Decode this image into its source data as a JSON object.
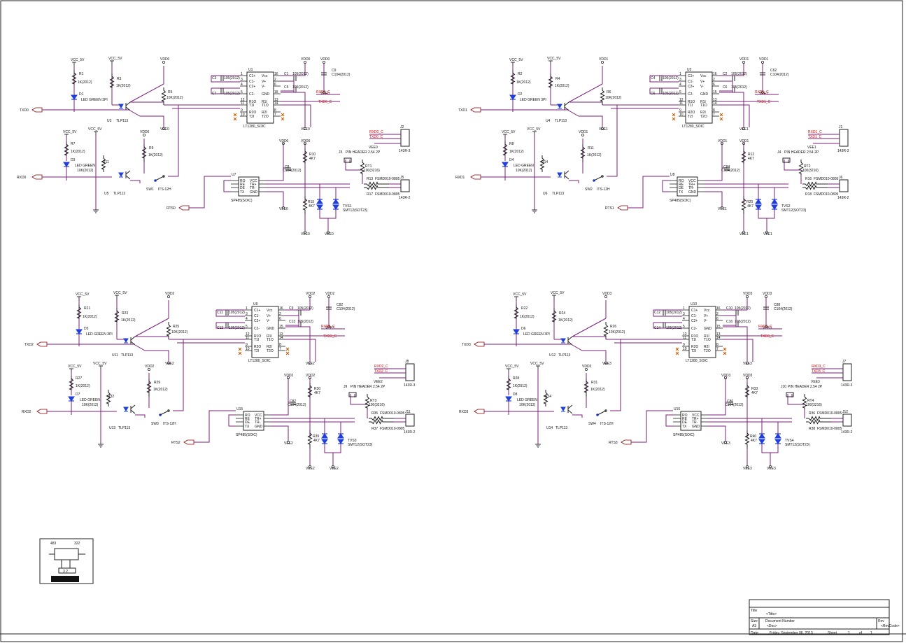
{
  "channels": [
    {
      "vcc_pwr_a": "VCC_5V",
      "vcc_pwr_b": "VCC_5V",
      "vcc_pwr_c": "VCC_5V",
      "vcc_pwr_d": "VCC_5V",
      "vdd": "VDD0",
      "vee": "VEE0",
      "txd": "TXD0",
      "rxd": "RXD0",
      "rts": "RTS0",
      "r_a": "R1",
      "r_a_val": "1K(2012)",
      "r_b": "R3",
      "r_b_val": "1K(2012)",
      "r_c": "R5",
      "r_c_val": "10K(2012)",
      "d_tx": "D1",
      "led_tx": "LED GREEN 3PI",
      "opto_tx": "U3",
      "opto_tx_type": "TLP113",
      "r_d": "R7",
      "r_d_val": "1K(2012)",
      "d_rx": "D3",
      "led_rx": "LED GREEN",
      "led_rx_val": "10K(2012)",
      "r_e": "R9",
      "r_e_val": "1K(2012)",
      "r_f": "R11",
      "opto_rx": "U5",
      "opto_rx_type": "TLP113",
      "sw": "SW1",
      "sw_type": "ITS-12H",
      "tx_chip": "U1",
      "tx_chip_type": "LT1280_SOIC",
      "cap_a": "C3",
      "cap_a_val": "105(2012)",
      "cap_b": "C7",
      "cap_b_val": "105(2012)",
      "cap_c": "C1",
      "cap_c_val": "105(2012)",
      "cap_d": "C5",
      "cap_d_val": "105(2012)",
      "cap_e": "C9",
      "cap_e_val": "C104(2012)",
      "rs_out_a": "RXD0_C",
      "rs_out_b": "TXD0_C",
      "hdr_a_label": "RXD0_C",
      "hdr_b_label": "TXD0_C",
      "conn_top": "J2",
      "conn_top_type": "143R-3",
      "hdr": "J3",
      "hdr_type": "PIN HEADER 2.54 2P",
      "r_g": "R10",
      "r_g_val": "4K7",
      "cap_f": "C8",
      "cap_f_val": "C104(2012)",
      "rt": "RT1",
      "rt_val": "100(3216)",
      "trans_chip": "U7",
      "trans_chip_type": "SP485(SOIC)",
      "r_h": "R13",
      "r_h_val": "FSMD010-0805",
      "r_i": "R17",
      "r_i_val": "FSMD010-0805",
      "conn_bot": "J5",
      "conn_bot_type": "143R-2",
      "r_j": "R15",
      "r_j_val": "4K7",
      "tvs": "TVS1",
      "tvs_type": "SMT12(SOT23)"
    },
    {
      "vcc_pwr_a": "VCC_5V",
      "vcc_pwr_b": "VCC_5V",
      "vcc_pwr_c": "VCC_5V",
      "vcc_pwr_d": "VCC_5V",
      "vdd": "VDD1",
      "vee": "VEE1",
      "txd": "TXD1",
      "rxd": "RXD1",
      "rts": "RTS1",
      "r_a": "R2",
      "r_a_val": "1K(2012)",
      "r_b": "R4",
      "r_b_val": "1K(2012)",
      "r_c": "R6",
      "r_c_val": "10K(2012)",
      "d_tx": "D2",
      "led_tx": "LED GREEN 3PI",
      "opto_tx": "U4",
      "opto_tx_type": "TLP113",
      "r_d": "R8",
      "r_d_val": "1K(2012)",
      "d_rx": "D4",
      "led_rx": "LED GREEN",
      "led_rx_val": "10K(2012)",
      "r_e": "R11",
      "r_e_val": "1K(2012)",
      "r_f": "R14",
      "opto_rx": "U6",
      "opto_rx_type": "TLP113",
      "sw": "SW2",
      "sw_type": "ITS-12H",
      "tx_chip": "U2",
      "tx_chip_type": "LT1280_SOIC",
      "cap_a": "C4",
      "cap_a_val": "105(2012)",
      "cap_b": "C6",
      "cap_b_val": "105(2012)",
      "cap_c": "C2",
      "cap_c_val": "105(2012)",
      "cap_d": "C6",
      "cap_d_val": "105(2012)",
      "cap_e": "C62",
      "cap_e_val": "C104(2012)",
      "rs_out_a": "RXD1_C",
      "rs_out_b": "TXD1_C",
      "hdr_a_label": "RXD1_C",
      "hdr_b_label": "TXD1_C",
      "conn_top": "J1",
      "conn_top_type": "143R-3",
      "hdr": "J4",
      "hdr_type": "PIN HEADER 2.54 2P",
      "r_g": "R12",
      "r_g_val": "4K7",
      "cap_f": "C84",
      "cap_f_val": "C104(2012)",
      "rt": "RT2",
      "rt_val": "100(3216)",
      "trans_chip": "U8",
      "trans_chip_type": "SP485(SOIC)",
      "r_h": "R16",
      "r_h_val": "FSMD010-0805",
      "r_i": "R18",
      "r_i_val": "FSMD010-0805",
      "conn_bot": "J6",
      "conn_bot_type": "143R-2",
      "r_j": "R20",
      "r_j_val": "4K7",
      "tvs": "TVS2",
      "tvs_type": "SMT12(SOT23)"
    },
    {
      "vcc_pwr_a": "VCC_5V",
      "vcc_pwr_b": "VCC_5V",
      "vcc_pwr_c": "VCC_5V",
      "vcc_pwr_d": "VCC_5V",
      "vdd": "VDD2",
      "vee": "VEE2",
      "txd": "TXD2",
      "rxd": "RXD2",
      "rts": "RTS2",
      "r_a": "R21",
      "r_a_val": "1K(2012)",
      "r_b": "R23",
      "r_b_val": "1K(2012)",
      "r_c": "R25",
      "r_c_val": "10K(2012)",
      "d_tx": "D5",
      "led_tx": "LED GREEN 3PI",
      "opto_tx": "U11",
      "opto_tx_type": "TLP113",
      "r_d": "R27",
      "r_d_val": "1K(2012)",
      "d_rx": "D7",
      "led_rx": "LED GREEN",
      "led_rx_val": "10K(2012)",
      "r_e": "R29",
      "r_e_val": "1K(2012)",
      "r_f": "R32",
      "opto_rx": "U13",
      "opto_rx_type": "TLP113",
      "sw": "SW3",
      "sw_type": "ITS-12H",
      "tx_chip": "U9",
      "tx_chip_type": "LT1280_SOIC",
      "cap_a": "C11",
      "cap_a_val": "105(2012)",
      "cap_b": "C12",
      "cap_b_val": "105(2012)",
      "cap_c": "C9",
      "cap_c_val": "105(2012)",
      "cap_d": "C13",
      "cap_d_val": "105(2012)",
      "cap_e": "C82",
      "cap_e_val": "C104(2012)",
      "rs_out_a": "RXD2_C",
      "rs_out_b": "TXD2_C",
      "hdr_a_label": "RXD2_C",
      "hdr_b_label": "TXD2_C",
      "conn_top": "J8",
      "conn_top_type": "143R-3",
      "hdr": "J9",
      "hdr_type": "PIN HEADER 2.54 2P",
      "r_g": "R30",
      "r_g_val": "4K7",
      "cap_f": "C87",
      "cap_f_val": "C104(2012)",
      "rt": "RT3",
      "rt_val": "100(3216)",
      "trans_chip": "U15",
      "trans_chip_type": "SP485(SOIC)",
      "r_h": "R35",
      "r_h_val": "FSMD010-0805",
      "r_i": "R37",
      "r_i_val": "FSMD010-0805",
      "conn_bot": "J11",
      "conn_bot_type": "143R-2",
      "r_j": "R39",
      "r_j_val": "4K7",
      "tvs": "TVS3",
      "tvs_type": "SMT12(SOT23)"
    },
    {
      "vcc_pwr_a": "VCC_5V",
      "vcc_pwr_b": "VCC_5V",
      "vcc_pwr_c": "VCC_5V",
      "vcc_pwr_d": "VCC_5V",
      "vdd": "VDD3",
      "vee": "VEE3",
      "txd": "TXD3",
      "rxd": "RXD3",
      "rts": "RTS3",
      "r_a": "R22",
      "r_a_val": "1K(2012)",
      "r_b": "R24",
      "r_b_val": "1K(2012)",
      "r_c": "R26",
      "r_c_val": "10K(2012)",
      "d_tx": "D6",
      "led_tx": "LED GREEN 3PI",
      "opto_tx": "U12",
      "opto_tx_type": "TLP113",
      "r_d": "R28",
      "r_d_val": "1K(2012)",
      "d_rx": "D8",
      "led_rx": "LED GREEN",
      "led_rx_val": "10K(2012)",
      "r_e": "R31",
      "r_e_val": "1K(2012)",
      "r_f": "R34",
      "opto_rx": "U14",
      "opto_rx_type": "TLP113",
      "sw": "SW4",
      "sw_type": "ITS-12H",
      "tx_chip": "U10",
      "tx_chip_type": "LT1280_SOIC",
      "cap_a": "C12",
      "cap_a_val": "105(2012)",
      "cap_b": "C14",
      "cap_b_val": "105(2012)",
      "cap_c": "C10",
      "cap_c_val": "105(2012)",
      "cap_d": "C16",
      "cap_d_val": "105(2012)",
      "cap_e": "C88",
      "cap_e_val": "C104(2012)",
      "rs_out_a": "RXD3_C",
      "rs_out_b": "TXD3_C",
      "hdr_a_label": "RXD3_C",
      "hdr_b_label": "TXD3_C",
      "conn_top": "J7",
      "conn_top_type": "143R-3",
      "hdr": "J10",
      "hdr_type": "PIN HEADER 2.54 2P",
      "r_g": "R33",
      "r_g_val": "4K7",
      "cap_f": "C86",
      "cap_f_val": "C104(2012)",
      "rt": "RT4",
      "rt_val": "100(3216)",
      "trans_chip": "U16",
      "trans_chip_type": "SP485(SOIC)",
      "r_h": "R36",
      "r_h_val": "FSMD010-0805",
      "r_i": "R38",
      "r_i_val": "FSMD010-0805",
      "conn_bot": "J12",
      "conn_bot_type": "143R-2",
      "r_j": "R40",
      "r_j_val": "4K7",
      "tvs": "TVS4",
      "tvs_type": "SMT12(SOT23)"
    }
  ],
  "chip_pins": {
    "tx_left": [
      "C1+",
      "C1-",
      "C2+",
      "C2-",
      "R1O",
      "T1I",
      "R2O",
      "T2I"
    ],
    "tx_right": [
      "Vcc",
      "V+",
      "V-",
      "GND",
      "R1I",
      "T1O",
      "R2I",
      "T2O"
    ],
    "tx_pin_nums_left": [
      "1",
      "3",
      "4",
      "5",
      "12",
      "11",
      "9",
      "10"
    ],
    "tx_pin_nums_right": [
      "16",
      "2",
      "6",
      "15",
      "13",
      "14",
      "8",
      "7"
    ],
    "trans_left": [
      "RO",
      "RE",
      "DE",
      "TX"
    ],
    "trans_right": [
      "VCC",
      "TR+",
      "TR-",
      "GND"
    ]
  },
  "reg_part": {
    "pin_a": "483",
    "pin_b": "322",
    "bottom": "3   2"
  },
  "title_block": {
    "title_label": "Title",
    "title_value": "<Title>",
    "size_label": "Size",
    "size_value": "A3",
    "doc_label": "Document Number",
    "doc_value": "<Doc>",
    "rev_label": "Rev",
    "rev_value": "<RevCode>",
    "date_label": "Date:",
    "date_value": "Friday, September 06, 2013",
    "sheet_label": "Sheet",
    "sheet_num": "1",
    "of_label": "of",
    "sheet_total": "1"
  },
  "colors": {
    "wire": "#7a1f7a",
    "diode": "#1f3fd8",
    "net_label": "#d40000",
    "part": "#202020"
  }
}
